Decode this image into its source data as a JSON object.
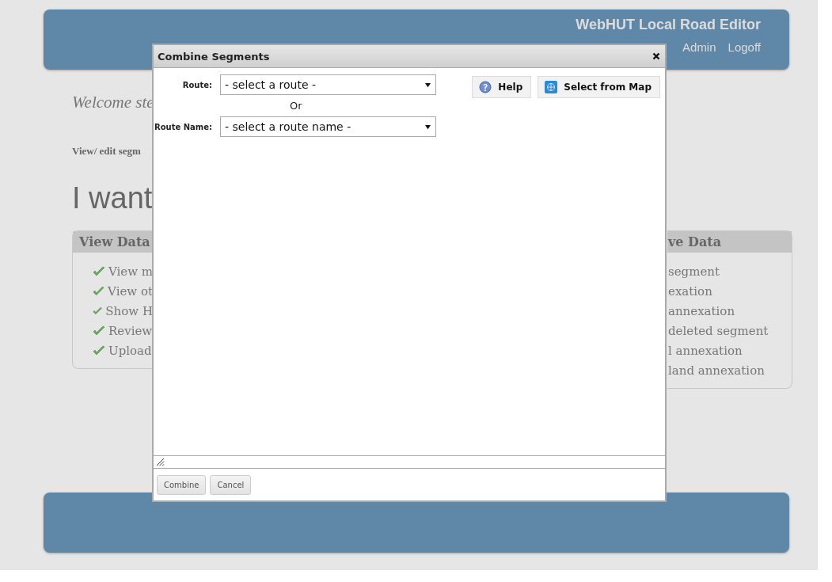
{
  "header": {
    "title": "WebHUT Local Road Editor",
    "links": [
      "Admin",
      "Logoff"
    ]
  },
  "welcome": "Welcome ste",
  "edit_link": "View/ edit segm",
  "heading": "I want",
  "view_panel": {
    "title": "View Data",
    "items": [
      "View m",
      "View ot",
      "Show H",
      "Review",
      "Upload"
    ]
  },
  "right_panel": {
    "title": "ve Data",
    "items": [
      "segment",
      "exation",
      "annexation",
      "deleted segment",
      "l annexation",
      "land annexation"
    ]
  },
  "dialog": {
    "title": "Combine Segments",
    "fields": [
      {
        "label": "Route:",
        "value": "- select a route -"
      },
      {
        "label": "Route Name:",
        "value": "- select a route name -"
      }
    ],
    "separator": "Or",
    "tools": [
      {
        "label": "Help",
        "kind": "help"
      },
      {
        "label": "Select from Map",
        "kind": "map"
      }
    ],
    "buttons": [
      "Combine",
      "Cancel"
    ]
  }
}
